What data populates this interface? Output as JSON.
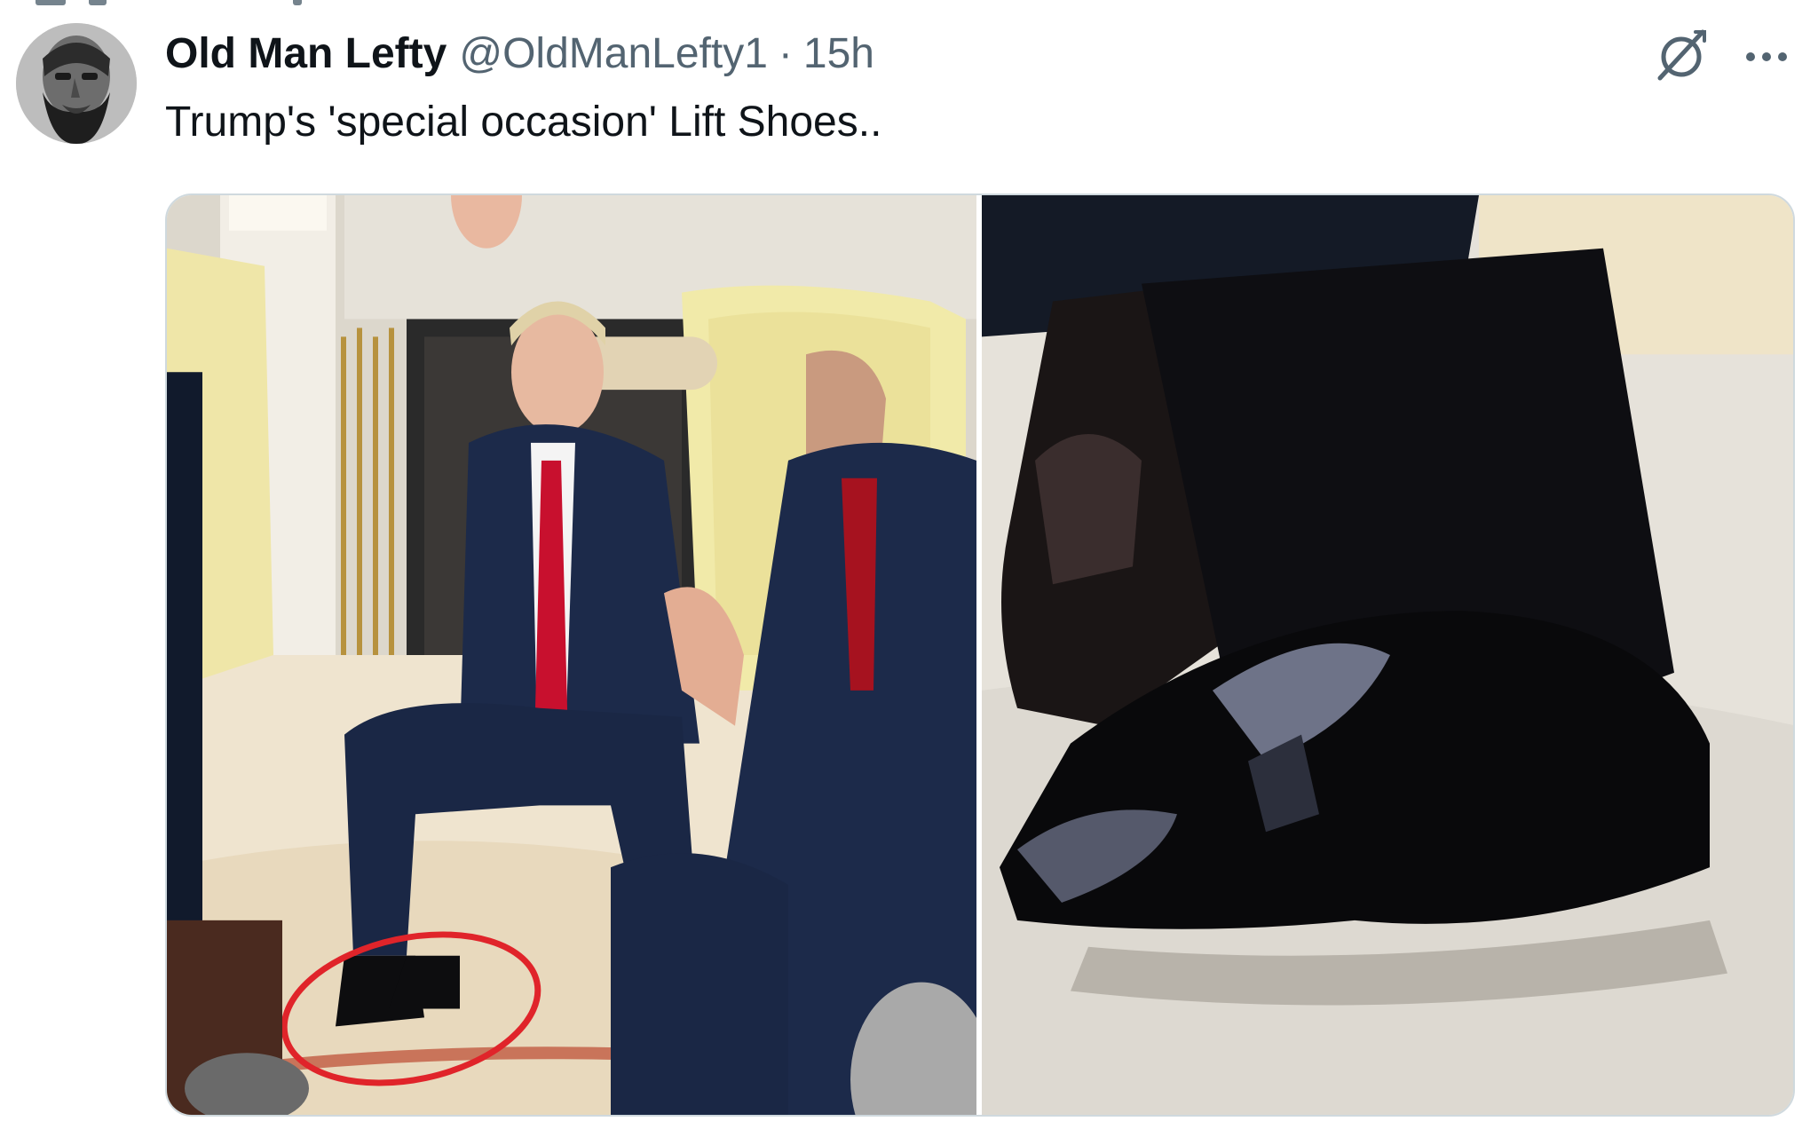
{
  "tweet": {
    "display_name": "Old Man Lefty",
    "handle": "@OldManLefty1",
    "separator": "·",
    "time": "15h",
    "text": "Trump's 'special occasion' Lift Shoes.."
  },
  "icons": {
    "grok": "grok-icon",
    "more": "more-horizontal-icon"
  },
  "media": {
    "count": 2,
    "highlight_color": "#e0242a"
  },
  "colors": {
    "text_primary": "#0f1419",
    "text_secondary": "#536471",
    "border": "#cfd9de"
  }
}
